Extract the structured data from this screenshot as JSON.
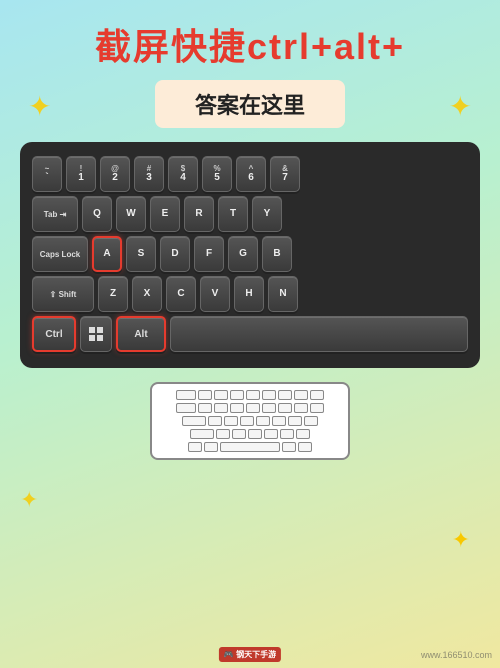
{
  "title": "截屏快捷ctrl+alt+",
  "answer": "答案在这里",
  "watermark": "www.166510.com",
  "keyboard": {
    "row1": [
      "~`",
      "!1",
      "@2",
      "#3",
      "$4",
      "%5",
      "^6",
      "&7"
    ],
    "row2_special": "Tab",
    "row2": [
      "Q",
      "W",
      "E",
      "R",
      "T",
      "Y"
    ],
    "row3_special": "Caps Lock",
    "row3": [
      "A",
      "S",
      "D",
      "F",
      "G",
      "B"
    ],
    "row4_special": "⇧ Shift",
    "row4": [
      "Z",
      "X",
      "C",
      "V",
      "H",
      "N"
    ],
    "row5": [
      "Ctrl",
      "Win",
      "Alt"
    ]
  },
  "highlight_keys": [
    "A",
    "Ctrl",
    "Alt"
  ],
  "stars": [
    "✦",
    "✦",
    "✦",
    "✦"
  ]
}
